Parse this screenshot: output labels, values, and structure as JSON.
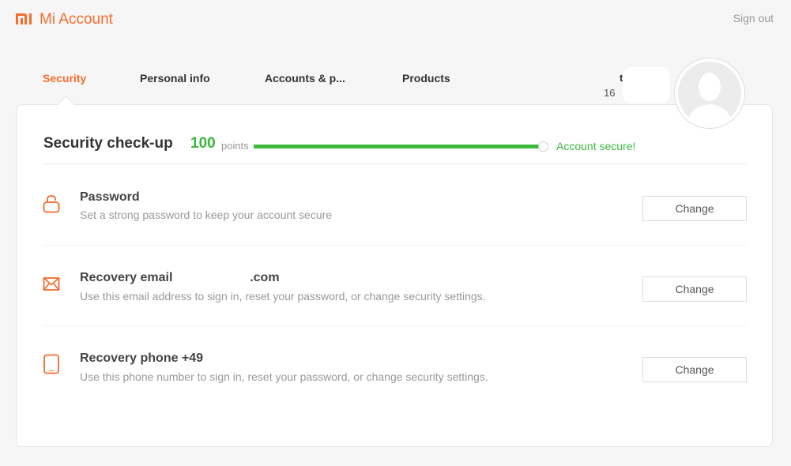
{
  "header": {
    "brand": "Mi Account",
    "sign_out": "Sign out"
  },
  "tabs": [
    {
      "label": "Security",
      "active": true
    },
    {
      "label": "Personal info",
      "active": false
    },
    {
      "label": "Accounts & p...",
      "active": false
    },
    {
      "label": "Products",
      "active": false
    }
  ],
  "user": {
    "name": "t",
    "id": "16"
  },
  "checkup": {
    "title": "Security check-up",
    "score": "100",
    "points_label": "points",
    "progress": 1.0,
    "status": "Account secure!"
  },
  "items": [
    {
      "title": "Password",
      "description": "Set a strong password to keep your account secure",
      "button": "Change",
      "icon": "lock-icon"
    },
    {
      "title": "Recovery email                      .com",
      "description": "Use this email address to sign in, reset your password, or change security settings.",
      "button": "Change",
      "icon": "mail-icon"
    },
    {
      "title": "Recovery phone +49",
      "description": "Use this phone number to sign in, reset your password, or change security settings.",
      "button": "Change",
      "icon": "phone-icon"
    }
  ],
  "colors": {
    "accent": "#f56c2d",
    "success": "#3bb93b",
    "muted": "#999999"
  }
}
